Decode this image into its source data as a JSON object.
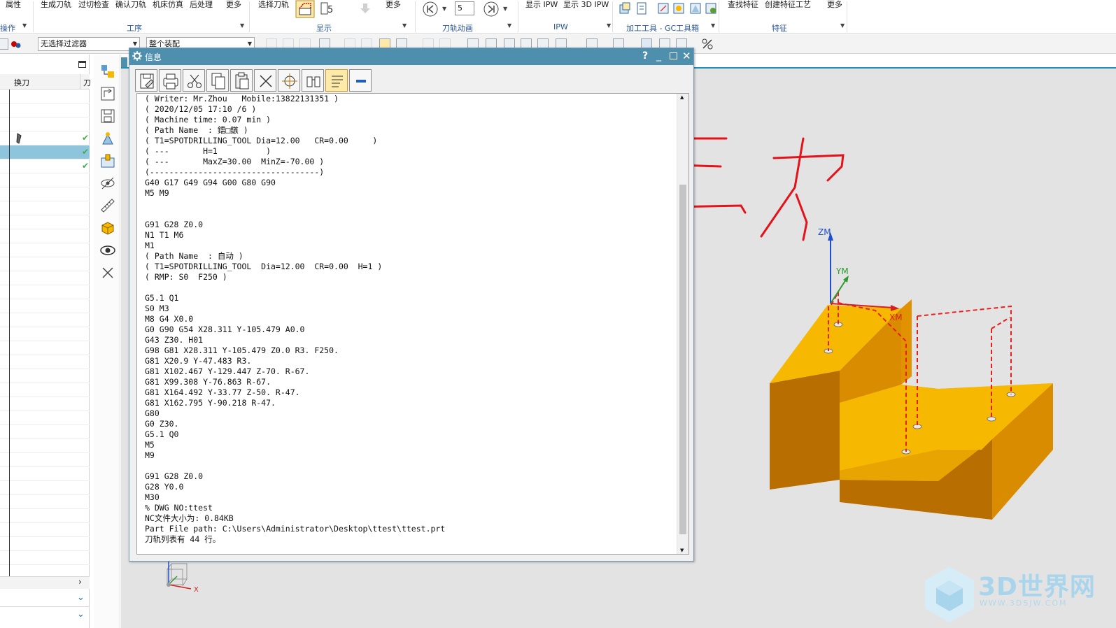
{
  "ribbon": {
    "buttons": [
      "属性",
      "生成刀轨",
      "过切检查",
      "确认刀轨",
      "机床仿真",
      "后处理",
      "更多",
      "选择刀轨",
      "更多",
      "显示 IPW",
      "显示 3D IPW",
      "查找特征",
      "创建特征工艺",
      "更多"
    ],
    "anim_speed": "5",
    "groups": [
      "操作",
      "工序",
      "显示",
      "刀轨动画",
      "IPW",
      "加工工具 - GC工具箱",
      "特征"
    ]
  },
  "filterbar": {
    "filter_value": "无选择过滤器",
    "scope_value": "整个装配"
  },
  "navigator": {
    "column_header": "换刀",
    "column_header2": "刀"
  },
  "info_window": {
    "title": "信息",
    "lines": [
      "( Writer: Mr.Zhou   Mobile:13822131351 )",
      "( 2020/12/05 17:10 /6 )",
      "( Machine time: 0.07 min )",
      "( Path Name  : 鐳□鏃 )",
      "( T1=SPOTDRILLING_TOOL Dia=12.00   CR=0.00     )",
      "( ---       H=1          )",
      "( ---       MaxZ=30.00  MinZ=-70.00 )",
      "(-----------------------------------)",
      "G40 G17 G49 G94 G00 G80 G90",
      "M5 M9",
      "",
      "",
      "G91 G28 Z0.0",
      "N1 T1 M6",
      "M1",
      "( Path Name  : 自动 )",
      "( T1=SPOTDRILLING_TOOL  Dia=12.00  CR=0.00  H=1 )",
      "( RMP: S0  F250 )",
      "",
      "G5.1 Q1",
      "S0 M3",
      "M8 G4 X0.0",
      "G0 G90 G54 X28.311 Y-105.479 A0.0",
      "G43 Z30. H01",
      "G98 G81 X28.311 Y-105.479 Z0.0 R3. F250.",
      "G81 X20.9 Y-47.483 R3.",
      "G81 X102.467 Y-129.447 Z-70. R-67.",
      "G81 X99.308 Y-76.863 R-67.",
      "G81 X164.492 Y-33.77 Z-50. R-47.",
      "G81 X162.795 Y-90.218 R-47.",
      "G80",
      "G0 Z30.",
      "G5.1 Q0",
      "M5",
      "M9",
      "",
      "G91 G28 Z0.0",
      "G28 Y0.0",
      "M30",
      "% DWG NO:ttest",
      "NC文件大小为: 0.84KB",
      "Part File path: C:\\Users\\Administrator\\Desktop\\ttest\\ttest.prt",
      "刀轨列表有 44 行。"
    ]
  },
  "viewport": {
    "axes": {
      "zm": "ZM",
      "ym": "YM",
      "xm": "XM"
    },
    "triad": {
      "z": "Z",
      "x": "X"
    },
    "part_top_color": "#f6b800",
    "part_side_color": "#d98c00",
    "part_front_color": "#b86e00",
    "toolpath_color": "#e8201c"
  },
  "watermark": {
    "text": "3D世界网",
    "url": "WWW.3DSJW.COM"
  },
  "colors": {
    "title_bar": "#4f8fae",
    "accent": "#1f8fb8",
    "ribbon_group_text": "#2b579a"
  }
}
